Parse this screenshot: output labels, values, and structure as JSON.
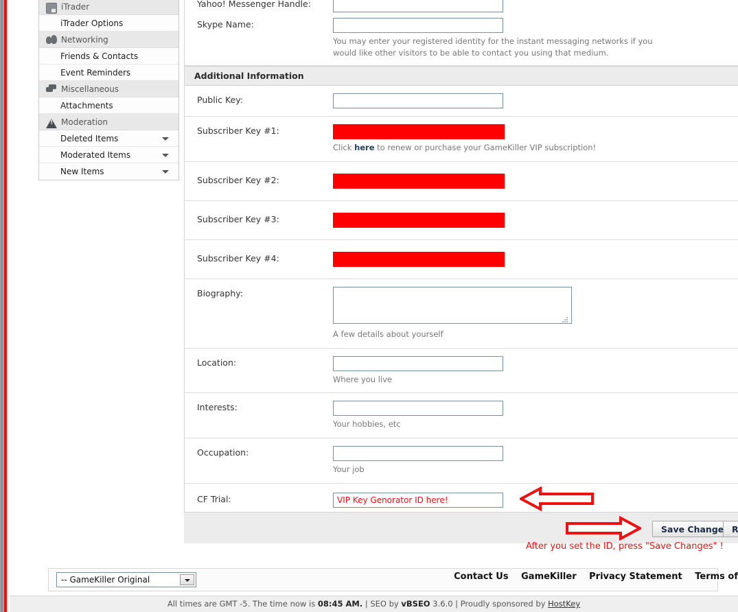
{
  "sidebar": {
    "items": [
      {
        "label": "iTrader",
        "type": "group",
        "icon": "itrader-icon"
      },
      {
        "label": "iTrader Options",
        "type": "item",
        "caret": false
      },
      {
        "label": "Networking",
        "type": "group",
        "icon": "people-icon"
      },
      {
        "label": "Friends & Contacts",
        "type": "item",
        "caret": false
      },
      {
        "label": "Event Reminders",
        "type": "item",
        "caret": false
      },
      {
        "label": "Miscellaneous",
        "type": "group",
        "icon": "speech-bubbles-icon"
      },
      {
        "label": "Attachments",
        "type": "item",
        "caret": false
      },
      {
        "label": "Moderation",
        "type": "group",
        "icon": "warning-triangle-icon"
      },
      {
        "label": "Deleted Items",
        "type": "item",
        "caret": true
      },
      {
        "label": "Moderated Items",
        "type": "item",
        "caret": true
      },
      {
        "label": "New Items",
        "type": "item",
        "caret": true
      }
    ]
  },
  "form": {
    "messaging": {
      "yahoo_label": "Yahoo! Messenger Handle:",
      "yahoo_value": "",
      "skype_label": "Skype Name:",
      "skype_value": "",
      "hint": "You may enter your registered identity for the instant messaging networks if you would like other visitors to be able to contact you using that medium."
    },
    "section_title": "Additional Information",
    "public_key": {
      "label": "Public Key:",
      "value": ""
    },
    "subscriber_keys": [
      {
        "label": "Subscriber Key #1:",
        "redacted": true,
        "hint_before": "Click ",
        "hint_link": "here",
        "hint_after": " to renew or purchase your GameKiller VIP subscription!"
      },
      {
        "label": "Subscriber Key #2:",
        "redacted": true
      },
      {
        "label": "Subscriber Key #3:",
        "redacted": true
      },
      {
        "label": "Subscriber Key #4:",
        "redacted": true
      }
    ],
    "biography": {
      "label": "Biography:",
      "value": "",
      "hint": "A few details about yourself"
    },
    "location": {
      "label": "Location:",
      "value": "",
      "hint": "Where you live"
    },
    "interests": {
      "label": "Interests:",
      "value": "",
      "hint": "Your hobbies, etc"
    },
    "occupation": {
      "label": "Occupation:",
      "value": "",
      "hint": "Your job"
    },
    "cf_trial": {
      "label": "CF Trial:",
      "value": "VIP Key Genorator ID here!"
    }
  },
  "buttons": {
    "save": "Save Changes",
    "reset": "Reset"
  },
  "annotations": {
    "cf_trial_note": "",
    "save_note": "After you set the ID, press \"Save Changes\" !"
  },
  "footer": {
    "style_selected": "-- GameKiller Original",
    "links": [
      "Contact Us",
      "GameKiller",
      "Privacy Statement",
      "Terms of"
    ],
    "status_prefix": "All times are GMT -5. The time now is ",
    "status_time": "08:45 AM.",
    "status_seo": " | SEO by ",
    "status_seo_name": "vBSEO",
    "status_seo_ver": " 3.6.0 | Proudly sponsored by ",
    "status_sponsor": "HostKey"
  },
  "colors": {
    "redact": "#ff0000",
    "annotation": "#ee1111",
    "field_border": "#7490a5",
    "header_bg": "#ececec"
  }
}
